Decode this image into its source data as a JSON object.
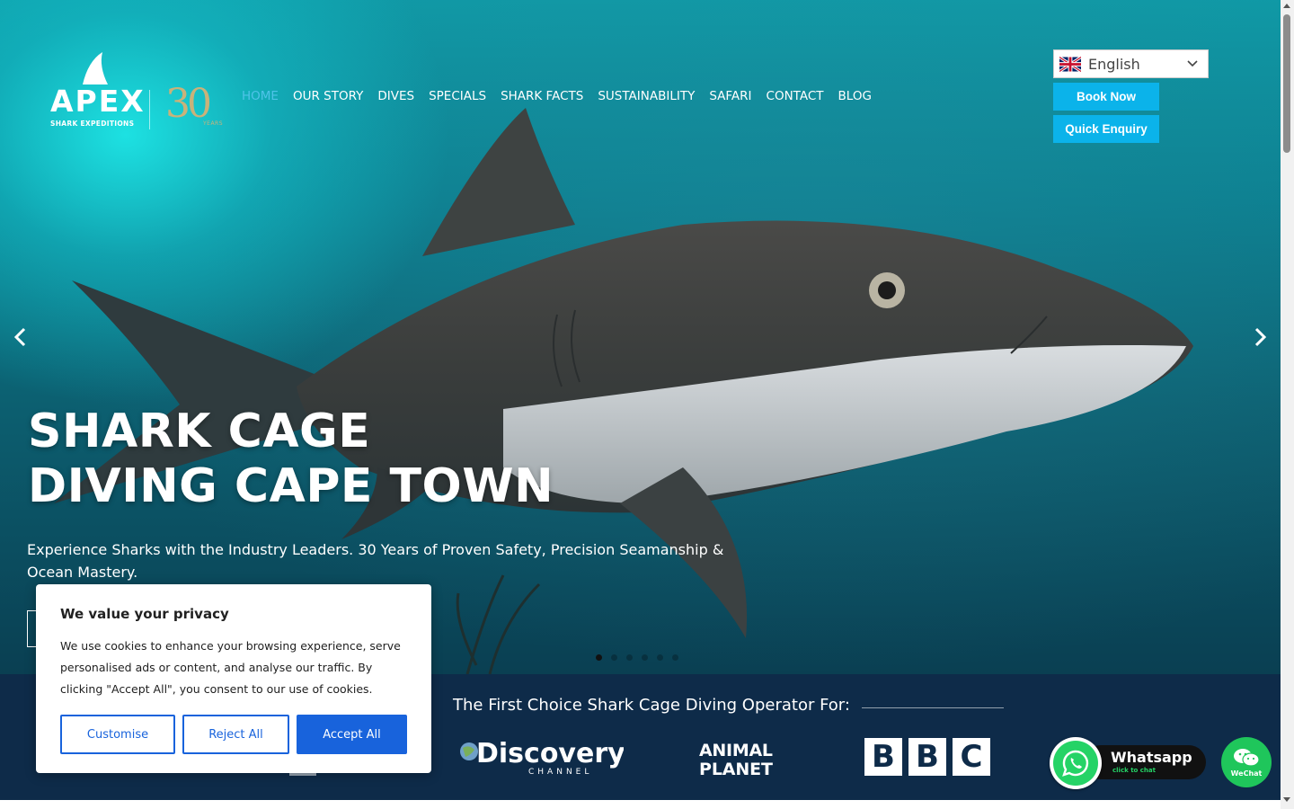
{
  "brand": {
    "logo_name": "APEX",
    "logo_tagline": "SHARK EXPEDITIONS",
    "anniversary": "30",
    "anniversary_sub": "YEARS"
  },
  "nav": {
    "items": [
      {
        "label": "HOME",
        "active": true
      },
      {
        "label": "OUR STORY",
        "active": false
      },
      {
        "label": "DIVES",
        "active": false
      },
      {
        "label": "SPECIALS",
        "active": false
      },
      {
        "label": "SHARK FACTS",
        "active": false
      },
      {
        "label": "SUSTAINABILITY",
        "active": false
      },
      {
        "label": "SAFARI",
        "active": false
      },
      {
        "label": "CONTACT",
        "active": false
      },
      {
        "label": "BLOG",
        "active": false
      }
    ]
  },
  "header_actions": {
    "language": "English",
    "language_flag_icon": "uk-flag-icon",
    "book_now": "Book Now",
    "quick_enquiry": "Quick Enquiry"
  },
  "hero": {
    "title_line1": "SHARK CAGE",
    "title_line2": "DIVING CAPE TOWN",
    "subtitle": "Experience Sharks with the Industry Leaders. 30 Years of Proven Safety, Precision Seamanship & Ocean Mastery.",
    "slides_total": 6,
    "active_slide": 1
  },
  "partners": {
    "title": "The First Choice Shark Cage Diving Operator For:",
    "logos": {
      "discovery_main": "Discovery",
      "discovery_sub": "CHANNEL",
      "animal_1": "ANIMAL",
      "animal_2": "PLANET",
      "bbc": [
        "B",
        "B",
        "C"
      ]
    }
  },
  "chat": {
    "whatsapp_title": "Whatsapp",
    "whatsapp_sub": "click to chat",
    "wechat": "WeChat"
  },
  "cookie": {
    "title": "We value your privacy",
    "text": "We use cookies to enhance your browsing experience, serve personalised ads or content, and analyse our traffic. By clicking \"Accept All\", you consent to our use of cookies.",
    "customise": "Customise",
    "reject": "Reject All",
    "accept": "Accept All"
  },
  "colors": {
    "accent": "#0bb3ea",
    "nav_active": "#4fc3e8",
    "band": "#0e2b49",
    "cookie_primary": "#1863dc",
    "whatsapp": "#25d366",
    "wechat": "#1fc65b"
  }
}
